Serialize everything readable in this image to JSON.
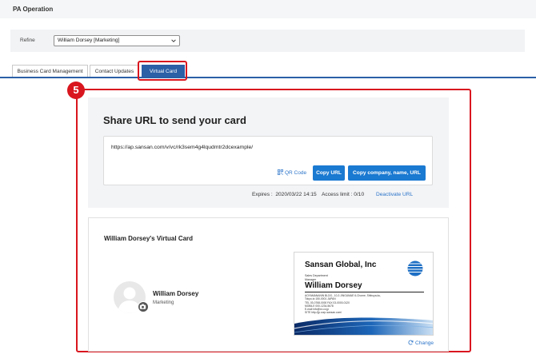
{
  "header": {
    "title": "PA Operation"
  },
  "refine": {
    "label": "Refine",
    "selected": "William Dorsey [Marketing]"
  },
  "tabs": [
    {
      "label": "Business Card Management",
      "active": false
    },
    {
      "label": "Contact Updates",
      "active": false
    },
    {
      "label": "Virtual Card",
      "active": true
    }
  ],
  "step": {
    "number": "5"
  },
  "share": {
    "title": "Share URL to send your card",
    "url": "https://ap.sansan.com/v/vc/rk3sem4g4lqudmtr2dcexample/",
    "qr_label": "QR Code",
    "copy_url_label": "Copy URL",
    "copy_company_label": "Copy company, name, URL",
    "expires": "Expires :  2020/03/22 14:15",
    "access_limit": "Access limit : 0/10",
    "deactivate_label": "Deactivate URL"
  },
  "vcard": {
    "title": "William Dorsey's Virtual Card",
    "name": "William Dorsey",
    "department": "Marketing",
    "change_label": "Change",
    "card": {
      "company": "Sansan Global, Inc",
      "dept": "Sales Department",
      "role": "Manager",
      "person": "William Dorsey",
      "lines": [
        "AOYAMANANIN BLDG., 10-3 JINGUMAE 6-Chome, Shibuya-ku,",
        "Tokyo-to 150-0001 JAPAN",
        "TEL 03-0768-0000   FAX 03-0000-0120",
        "MOBILE 000-1234-5678",
        "E-mail info@xx.co.jp",
        "SITE http://jp.corp-sansan.com/"
      ]
    }
  },
  "colors": {
    "accent": "#2b5fa6",
    "highlight": "#d9161e",
    "button": "#1a79d1",
    "link": "#2b74c9"
  }
}
